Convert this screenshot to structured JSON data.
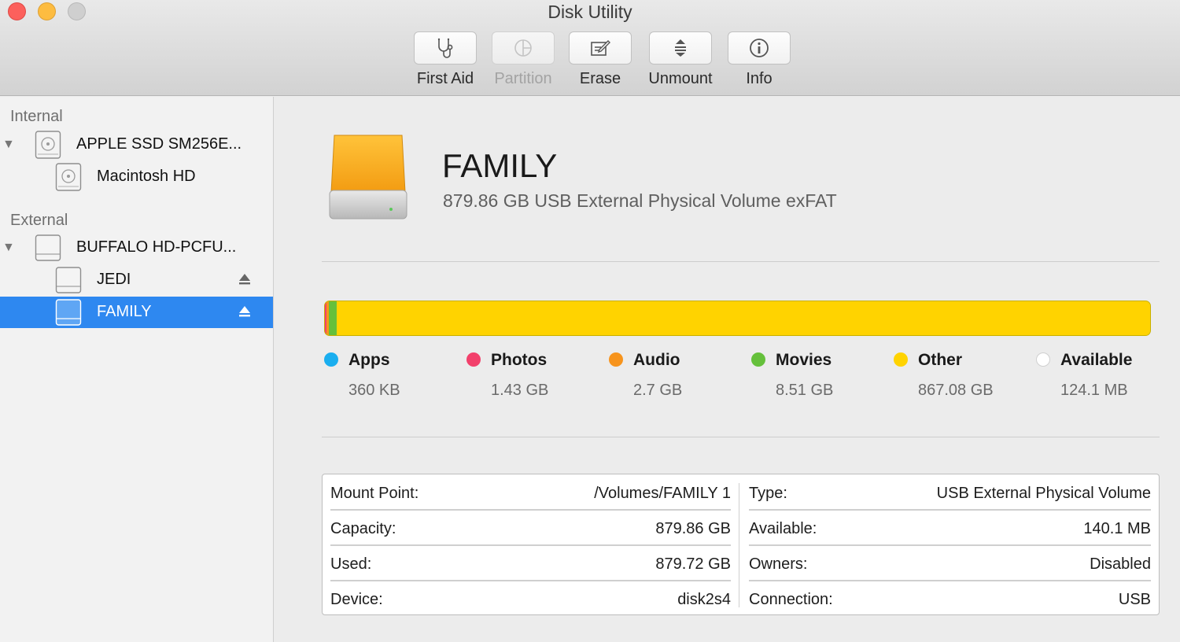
{
  "window": {
    "title": "Disk Utility"
  },
  "toolbar": {
    "first_aid": {
      "label": "First Aid",
      "icon": "stethoscope-icon"
    },
    "partition": {
      "label": "Partition",
      "icon": "partition-pie-icon",
      "enabled": false
    },
    "erase": {
      "label": "Erase",
      "icon": "erase-pencil-icon"
    },
    "unmount": {
      "label": "Unmount",
      "icon": "unmount-icon"
    },
    "info": {
      "label": "Info",
      "icon": "info-icon"
    }
  },
  "sidebar": {
    "internal_header": "Internal",
    "external_header": "External",
    "items": [
      {
        "label": "APPLE SSD SM256E...",
        "icon": "internal-disk-icon",
        "level": 0,
        "expanded": true
      },
      {
        "label": "Macintosh HD",
        "icon": "internal-volume-icon",
        "level": 1
      },
      {
        "label": "BUFFALO HD-PCFU...",
        "icon": "external-disk-icon",
        "level": 0,
        "expanded": true
      },
      {
        "label": "JEDI",
        "icon": "external-volume-icon",
        "level": 1,
        "ejectable": true
      },
      {
        "label": "FAMILY",
        "icon": "external-volume-icon",
        "level": 1,
        "ejectable": true,
        "selected": true
      }
    ]
  },
  "volume": {
    "name": "FAMILY",
    "description": "879.86 GB USB External Physical Volume exFAT",
    "icon": "external-drive-orange-icon"
  },
  "usage": {
    "capacity_gb": 879.86,
    "segments": [
      {
        "name": "Apps",
        "size": "360 KB",
        "gb": 0.00036,
        "color": "#1aaeef"
      },
      {
        "name": "Photos",
        "size": "1.43 GB",
        "gb": 1.43,
        "color": "#f2406b"
      },
      {
        "name": "Audio",
        "size": "2.7 GB",
        "gb": 2.7,
        "color": "#f7941d"
      },
      {
        "name": "Movies",
        "size": "8.51 GB",
        "gb": 8.51,
        "color": "#65c03b"
      },
      {
        "name": "Other",
        "size": "867.08 GB",
        "gb": 867.08,
        "color": "#ffd300"
      },
      {
        "name": "Available",
        "size": "124.1 MB",
        "gb": 0.1241,
        "color": "#ffffff"
      }
    ]
  },
  "details": {
    "left": [
      {
        "key": "Mount Point:",
        "value": "/Volumes/FAMILY 1"
      },
      {
        "key": "Capacity:",
        "value": "879.86 GB"
      },
      {
        "key": "Used:",
        "value": "879.72 GB"
      },
      {
        "key": "Device:",
        "value": "disk2s4"
      }
    ],
    "right": [
      {
        "key": "Type:",
        "value": "USB External Physical Volume"
      },
      {
        "key": "Available:",
        "value": "140.1 MB"
      },
      {
        "key": "Owners:",
        "value": "Disabled"
      },
      {
        "key": "Connection:",
        "value": "USB"
      }
    ]
  }
}
